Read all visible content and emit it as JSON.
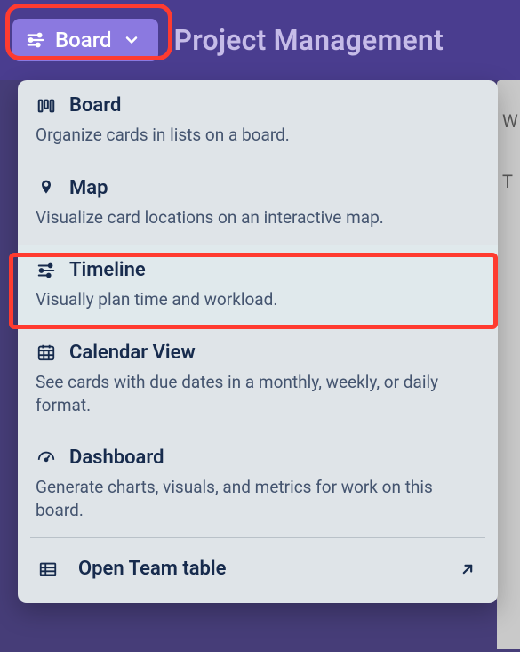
{
  "header": {
    "switcher_label": "Board",
    "title": "Project Management"
  },
  "dropdown": {
    "items": [
      {
        "title": "Board",
        "desc": "Organize cards in lists on a board.",
        "icon": "board-icon"
      },
      {
        "title": "Map",
        "desc": "Visualize card locations on an interactive map.",
        "icon": "map-pin-icon"
      },
      {
        "title": "Timeline",
        "desc": "Visually plan time and workload.",
        "icon": "timeline-icon"
      },
      {
        "title": "Calendar View",
        "desc": "See cards with due dates in a monthly, weekly, or daily format.",
        "icon": "calendar-icon"
      },
      {
        "title": "Dashboard",
        "desc": "Generate charts, visuals, and metrics for work on this board.",
        "icon": "gauge-icon"
      }
    ],
    "open_team_table": "Open Team table"
  },
  "annotation": {
    "highlighted_button": "view-switcher",
    "highlighted_item_index": 2
  },
  "rightpeek": {
    "a": "W",
    "b": "T"
  }
}
